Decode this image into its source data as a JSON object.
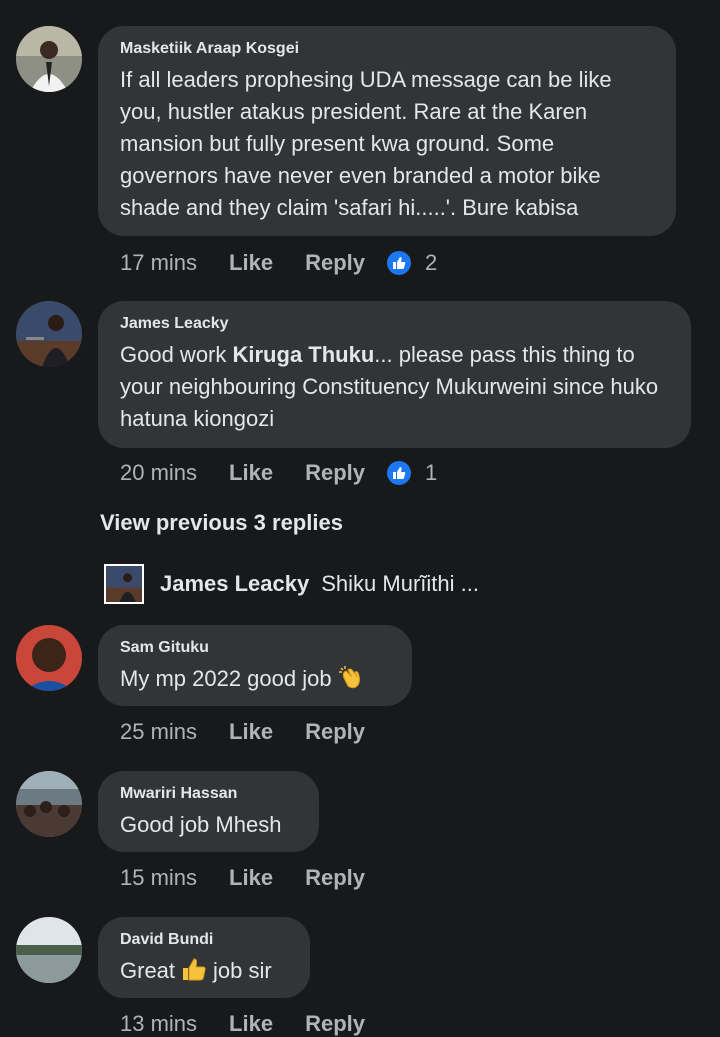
{
  "comments": [
    {
      "author": "Masketiik Araap Kosgei",
      "text": "If all leaders prophesing UDA message can be like you, hustler atakus president. Rare at the Karen mansion but fully present kwa ground. Some governors have never even branded a motor bike shade and they claim 'safari hi.....'. Bure kabisa",
      "time": "17 mins",
      "like_label": "Like",
      "reply_label": "Reply",
      "reaction_count": "2"
    },
    {
      "author": "James Leacky",
      "text_before": "Good work ",
      "mention": "Kiruga Thuku",
      "text_after": "... please pass this thing to your neighbouring Constituency Mukurweini since huko hatuna kiongozi",
      "time": "20 mins",
      "like_label": "Like",
      "reply_label": "Reply",
      "reaction_count": "1"
    },
    {
      "author": "Sam Gituku",
      "text": "My mp 2022 good job",
      "emoji": "clapping-hands-icon",
      "time": "25 mins",
      "like_label": "Like",
      "reply_label": "Reply"
    },
    {
      "author": "Mwariri Hassan",
      "text": "Good job Mhesh",
      "time": "15 mins",
      "like_label": "Like",
      "reply_label": "Reply"
    },
    {
      "author": "David Bundi",
      "text_before": "Great",
      "emoji": "thumbs-up-icon",
      "text_after": "job sir",
      "time": "13 mins",
      "like_label": "Like",
      "reply_label": "Reply"
    }
  ],
  "view_previous_replies": "View previous 3 replies",
  "reply_preview": {
    "author": "James Leacky",
    "text": "Shiku Murĩithi ..."
  },
  "colors": {
    "background": "#18191b",
    "bubble": "#333436",
    "secondary_text": "#b0b3b8",
    "like_blue": "#1d77f2"
  }
}
